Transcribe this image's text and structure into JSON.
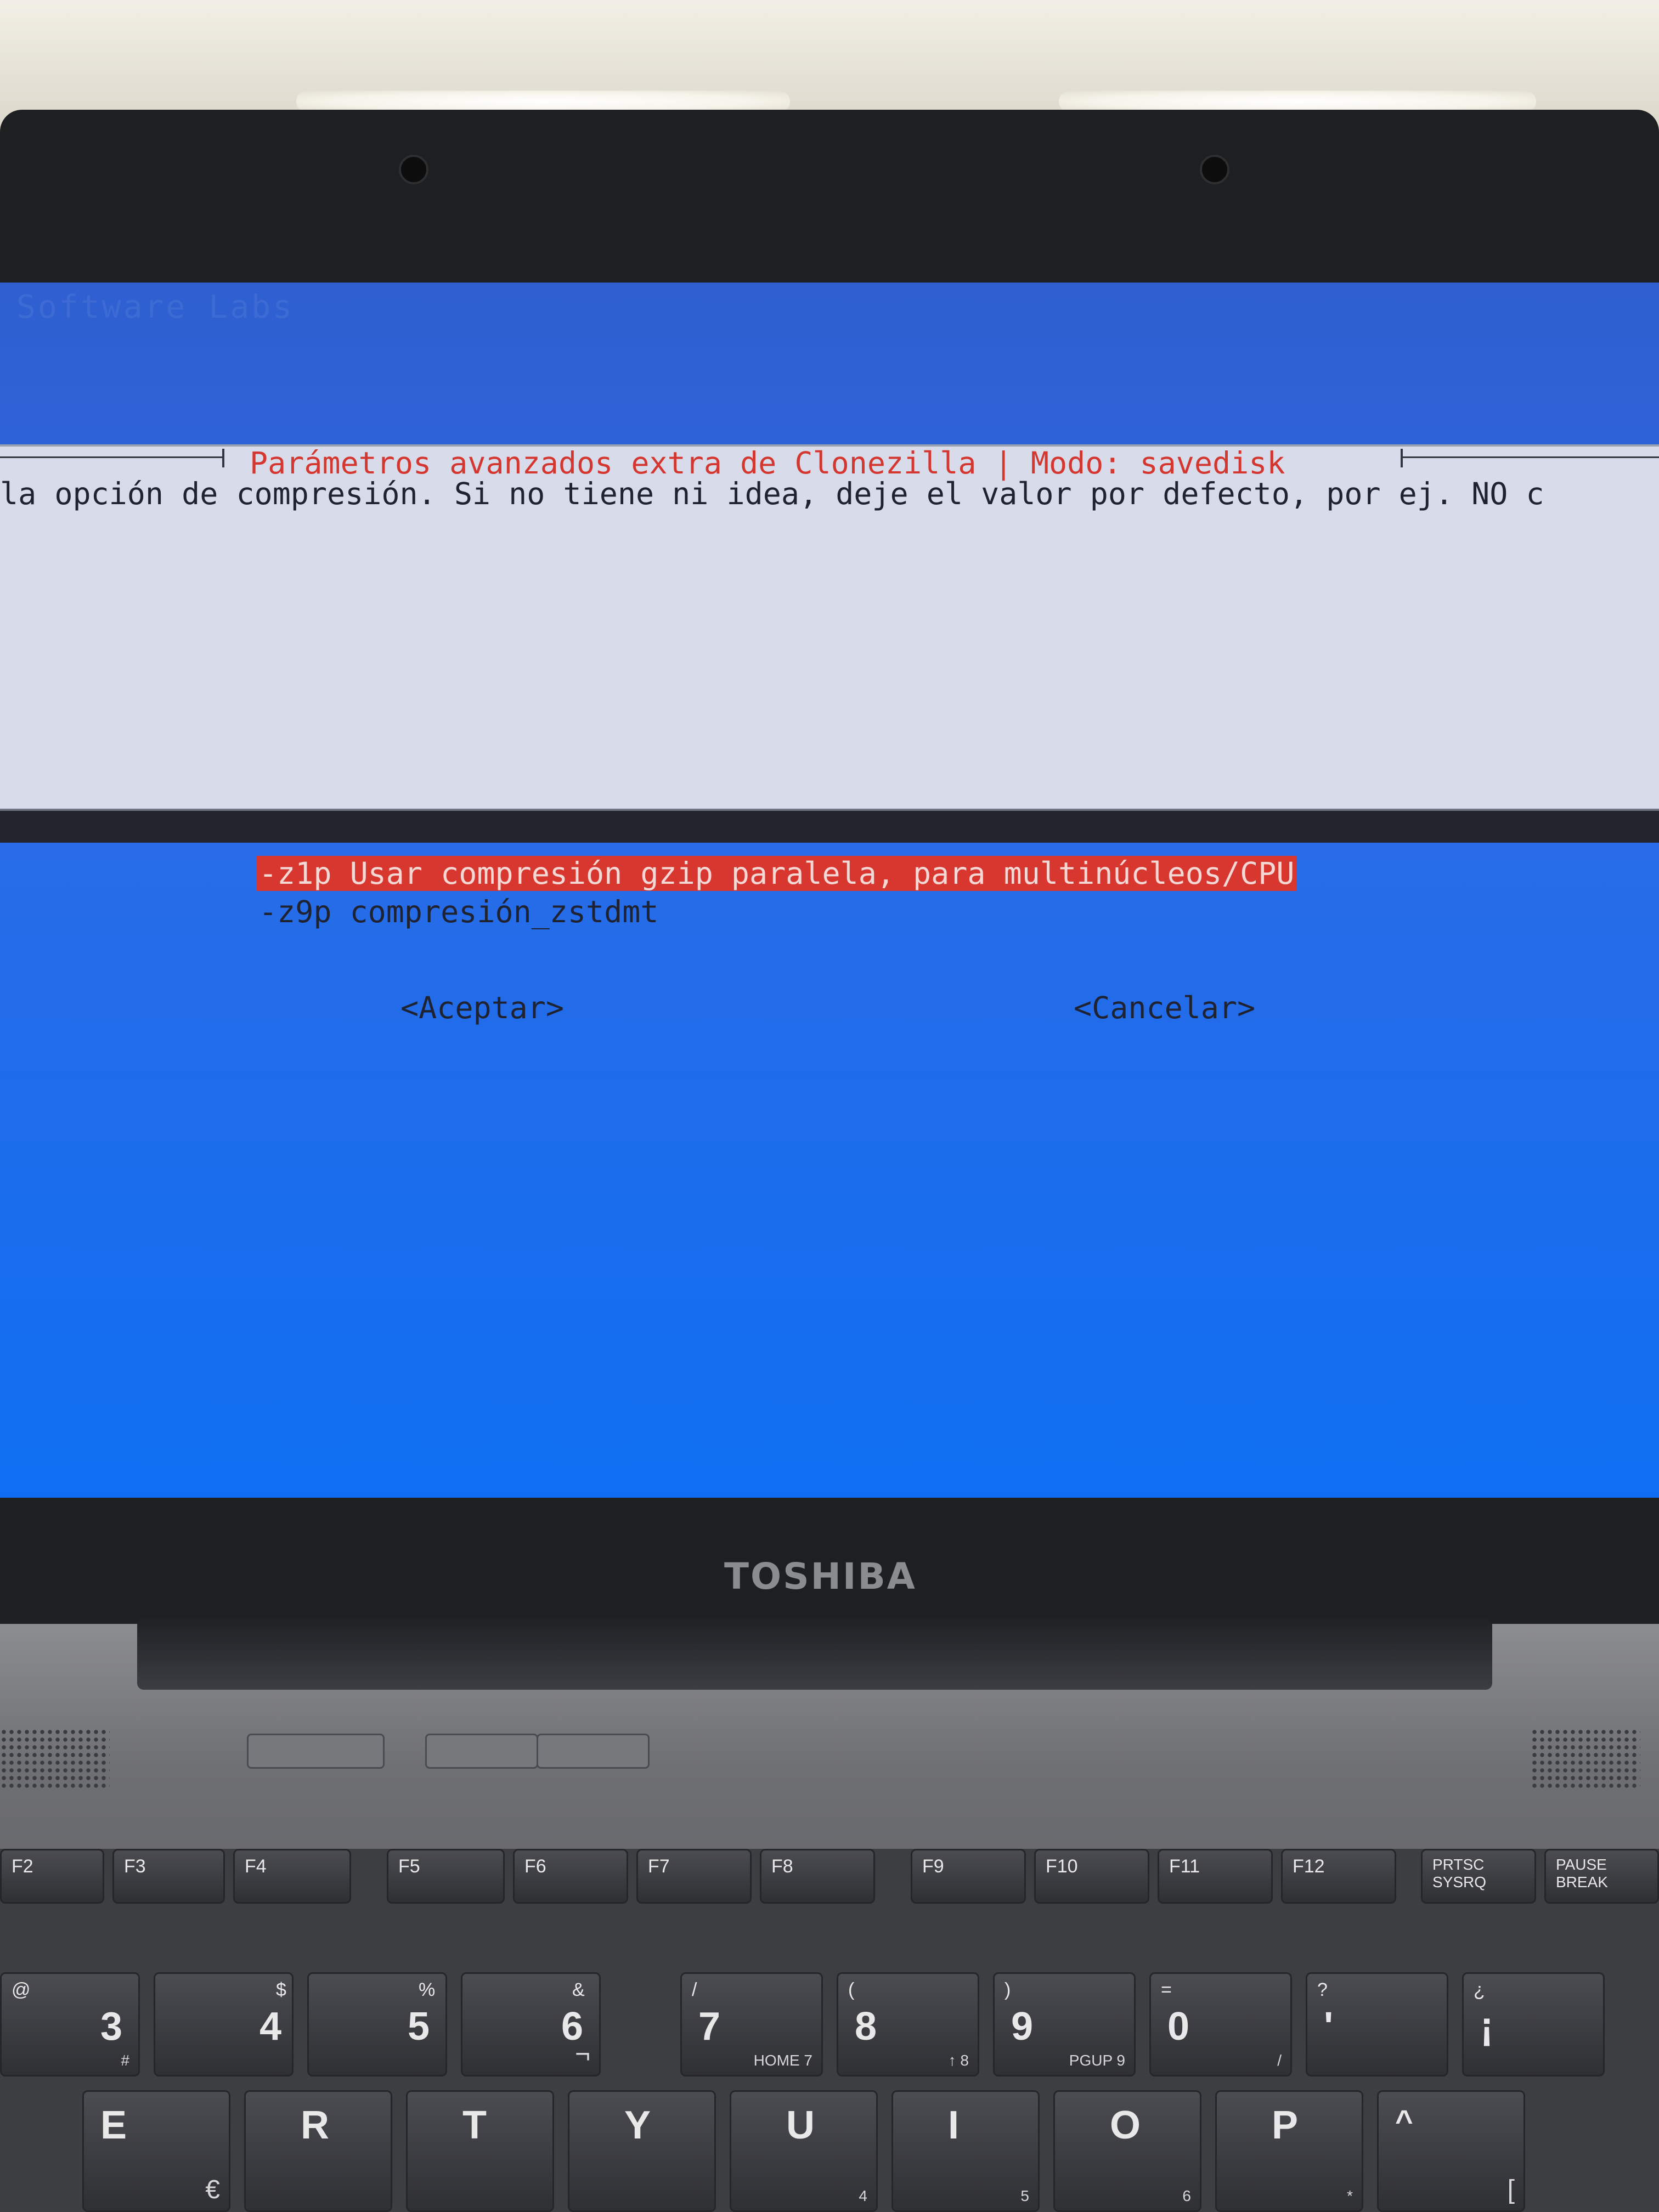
{
  "screen": {
    "ghost_text": "Software Labs",
    "dialog": {
      "title": "Parámetros avanzados extra de Clonezilla | Modo: savedisk",
      "prompt": "la opción de compresión. Si no tiene ni idea, deje el valor por defecto, por ej. NO c",
      "options": [
        {
          "label": "-z1p Usar compresión gzip paralela, para multinúcleos/CPU",
          "selected": true
        },
        {
          "label": "-z9p compresión_zstdmt",
          "selected": false
        }
      ],
      "buttons": {
        "ok": "<Aceptar>",
        "cancel": "<Cancelar>"
      }
    }
  },
  "laptop": {
    "brand": "TOSHIBA"
  },
  "keyboard": {
    "function_row": [
      {
        "label": "F2"
      },
      {
        "label": "F3"
      },
      {
        "label": "F4"
      },
      {
        "label": "F5"
      },
      {
        "label": "F6"
      },
      {
        "label": "F7"
      },
      {
        "label": "F8"
      },
      {
        "label": "F9"
      },
      {
        "label": "F10"
      },
      {
        "label": "F11"
      },
      {
        "label": "F12"
      },
      {
        "label": "PRTSC SYSRQ"
      },
      {
        "label": "PAUSE BREAK"
      }
    ],
    "number_row": [
      {
        "top": "@",
        "main": "3",
        "sub": "#"
      },
      {
        "top": "$",
        "main": "4",
        "sub": ""
      },
      {
        "top": "%",
        "main": "5",
        "sub": ""
      },
      {
        "top": "&",
        "main": "6",
        "sub": "¬"
      },
      {
        "top": "/",
        "main": "7",
        "sub": "HOME 7"
      },
      {
        "top": "(",
        "main": "8",
        "sub": "↑ 8"
      },
      {
        "top": ")",
        "main": "9",
        "sub": "PGUP 9"
      },
      {
        "top": "=",
        "main": "0",
        "sub": "/"
      },
      {
        "top": "?",
        "main": "'",
        "sub": ""
      },
      {
        "top": "¿",
        "main": "¡",
        "sub": ""
      }
    ],
    "letter_row": [
      {
        "main": "E",
        "sub": "€"
      },
      {
        "main": "R",
        "sub": ""
      },
      {
        "main": "T",
        "sub": ""
      },
      {
        "main": "Y",
        "sub": ""
      },
      {
        "main": "U",
        "sub": "4"
      },
      {
        "main": "I",
        "sub": "5"
      },
      {
        "main": "O",
        "sub": "6"
      },
      {
        "main": "P",
        "sub": "*"
      },
      {
        "main": "^",
        "sub": "["
      }
    ]
  },
  "colors": {
    "screen_blue": "#2b6be6",
    "dialog_bg": "#d8dcea",
    "title_red": "#d43730",
    "highlight_red": "#d7372e"
  }
}
